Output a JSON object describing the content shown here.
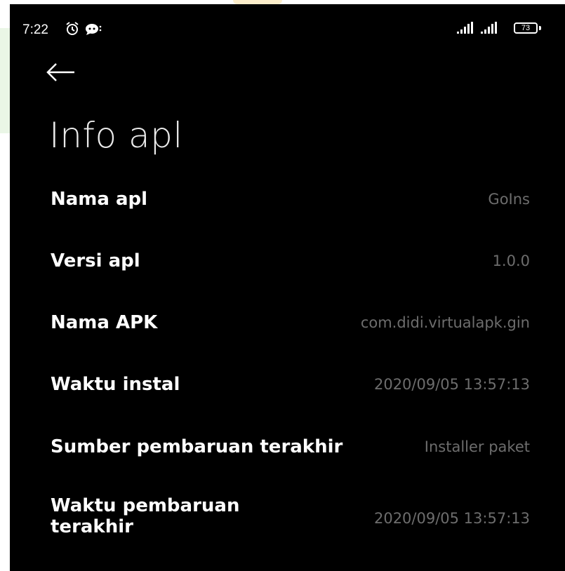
{
  "status_bar": {
    "time": "7:22",
    "battery_level": "73",
    "icons": [
      "alarm-icon",
      "chat-bubble-icon",
      "signal-icon",
      "signal-icon",
      "battery-icon"
    ]
  },
  "header": {
    "back_icon": "arrow-left-icon",
    "title": "Info apl"
  },
  "info": {
    "items": [
      {
        "label": "Nama apl",
        "value": "GoIns"
      },
      {
        "label": "Versi apl",
        "value": "1.0.0"
      },
      {
        "label": "Nama APK",
        "value": "com.didi.virtualapk.gin"
      },
      {
        "label": "Waktu instal",
        "value": "2020/09/05 13:57:13"
      },
      {
        "label": "Sumber pembaruan terakhir",
        "value": "Installer paket"
      },
      {
        "label": "Waktu pembaruan terakhir",
        "value": "2020/09/05 13:57:13"
      }
    ]
  },
  "colors": {
    "background": "#000000",
    "label": "#ffffff",
    "value": "#6d6d6d",
    "title": "#e9e9e9"
  }
}
